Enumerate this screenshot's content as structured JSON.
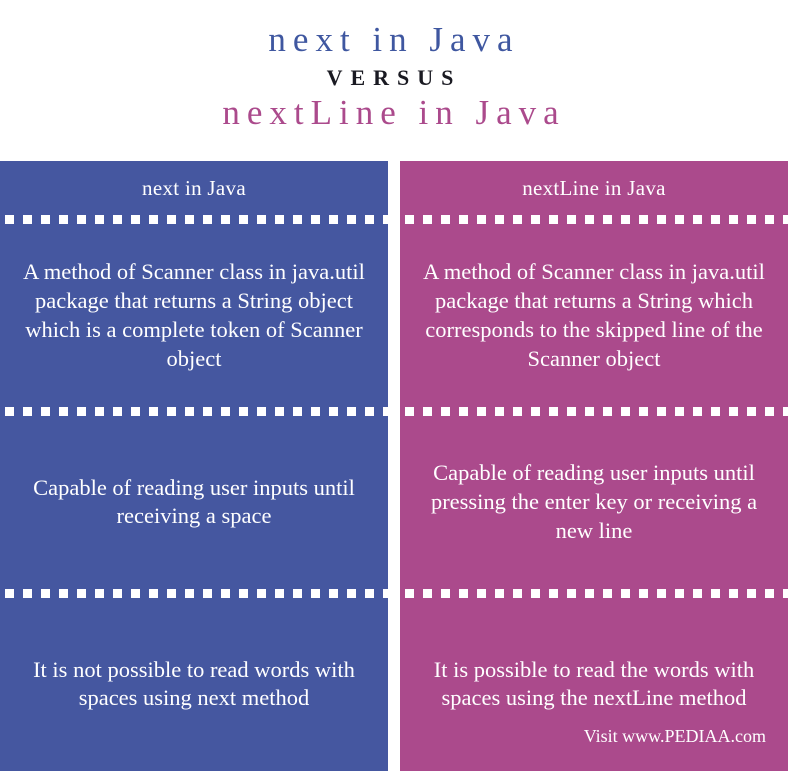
{
  "header": {
    "title_top": "next in Java",
    "versus_label": "VERSUS",
    "title_bottom": "nextLine in Java"
  },
  "colors": {
    "left_panel": "#4557a0",
    "right_panel": "#ab4a8c",
    "title_top_color": "#3f57a0",
    "title_bottom_color": "#ab4a8c",
    "versus_color": "#1a1a22",
    "text_color": "#ffffff",
    "background": "#ffffff"
  },
  "comparison": {
    "left": {
      "heading": "next in Java",
      "rows": [
        "A method of Scanner class in java.util package that returns a String object which is a complete token of Scanner object",
        "Capable of reading user inputs until receiving a space",
        "It is not possible to read words with spaces using next method"
      ]
    },
    "right": {
      "heading": "nextLine in Java",
      "rows": [
        "A method of Scanner class in java.util package that returns a String which corresponds to the skipped line of the Scanner object",
        "Capable of reading user inputs until pressing the enter key or receiving a new line",
        "It is possible to read the words with spaces using the nextLine method"
      ]
    }
  },
  "footer": {
    "attribution": "Visit www.PEDIAA.com"
  }
}
